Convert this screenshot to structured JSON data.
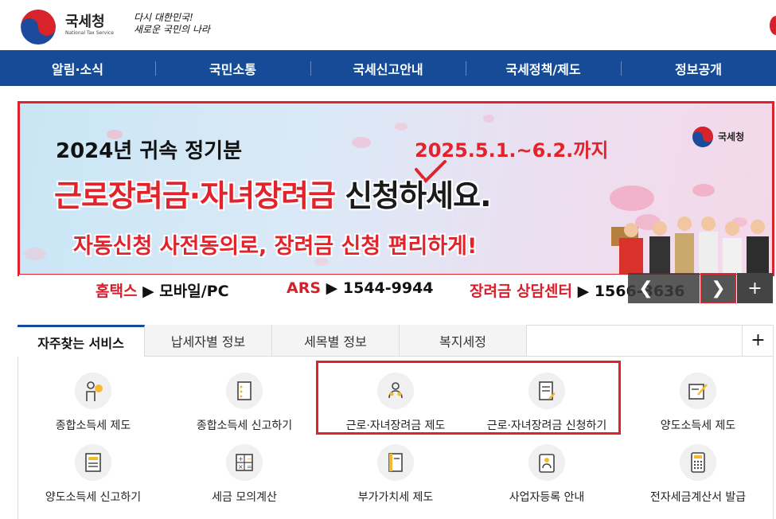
{
  "header": {
    "logo_name": "국세청",
    "logo_sub": "National Tax Service",
    "slogan_line1": "다시 대한민국!",
    "slogan_line2": "새로운 국민의 나라"
  },
  "gnb": {
    "items": [
      "알림·소식",
      "국민소통",
      "국세신고안내",
      "국세정책/제도",
      "정보공개"
    ]
  },
  "banner": {
    "line1": "2024년 귀속 정기분",
    "date": "2025.5.1.~6.2.까지",
    "line2_red": "근로장려금·자녀장려금",
    "line2_dark": "신청하세요.",
    "line3": "자동신청 사전동의로, 장려금 신청 편리하게!",
    "logo_name": "국세청",
    "strip": {
      "hometax_label": "홈택스",
      "hometax_value": "▶ 모바일/PC",
      "ars_label": "ARS",
      "ars_value": "▶ 1544-9944",
      "center_label": "장려금 상담센터",
      "center_value": "▶ 1566-3636"
    },
    "controls": {
      "prev": "❮",
      "next": "❯",
      "more": "+"
    }
  },
  "services": {
    "tabs": [
      "자주찾는 서비스",
      "납세자별 정보",
      "세목별 정보",
      "복지세정"
    ],
    "more": "+",
    "items": [
      {
        "label": "종합소득세 제도",
        "icon": "person-bulb-icon"
      },
      {
        "label": "종합소득세 신고하기",
        "icon": "document-icon"
      },
      {
        "label": "근로·자녀장려금 제도",
        "icon": "family-icon"
      },
      {
        "label": "근로·자녀장려금 신청하기",
        "icon": "form-pen-icon"
      },
      {
        "label": "양도소득세 제도",
        "icon": "book-pen-icon"
      },
      {
        "label": "양도소득세 신고하기",
        "icon": "report-icon"
      },
      {
        "label": "세금 모의계산",
        "icon": "calculator-icon"
      },
      {
        "label": "부가가치세 제도",
        "icon": "book-icon"
      },
      {
        "label": "사업자등록 안내",
        "icon": "id-card-icon"
      },
      {
        "label": "전자세금계산서 발급",
        "icon": "keypad-icon"
      }
    ]
  }
}
